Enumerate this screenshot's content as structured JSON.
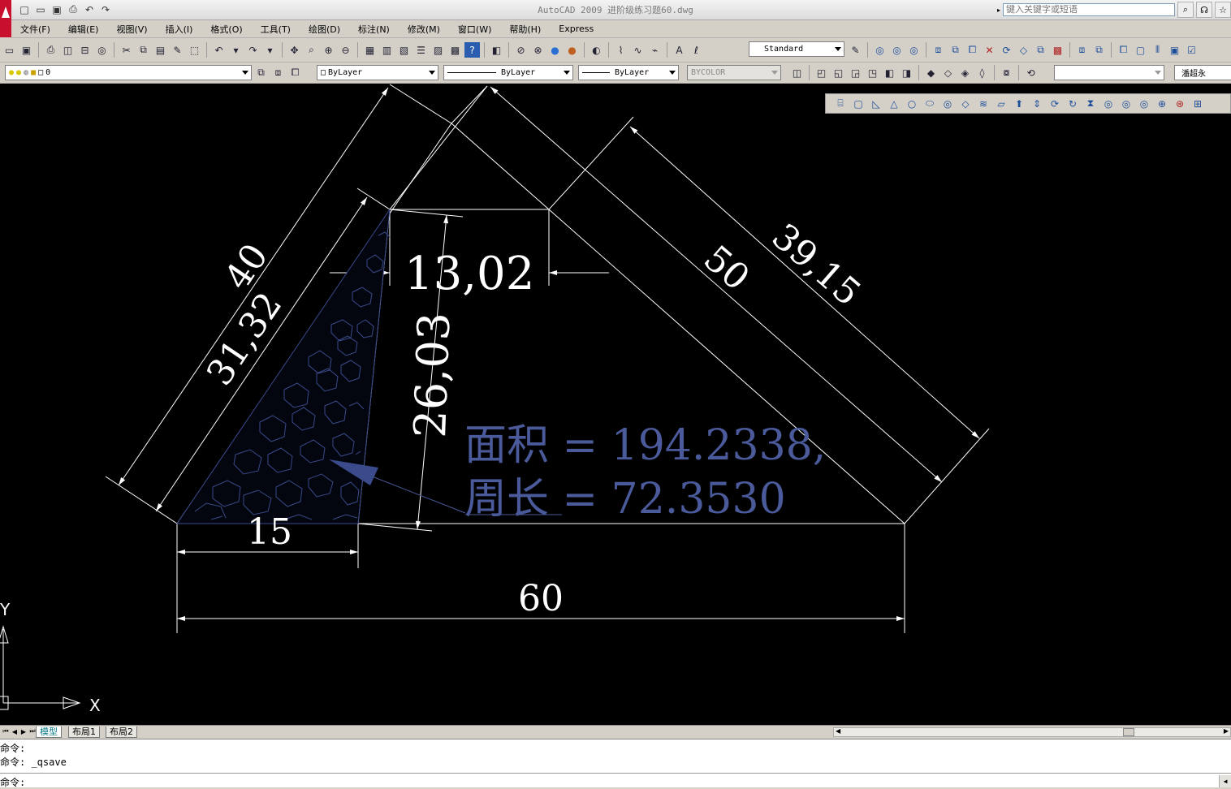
{
  "title": {
    "text": "AutoCAD 2009 进阶级练习题60.dwg",
    "search_placeholder": "键入关键字或短语"
  },
  "menu": [
    "文件(F)",
    "编辑(E)",
    "视图(V)",
    "插入(I)",
    "格式(O)",
    "工具(T)",
    "绘图(D)",
    "标注(N)",
    "修改(M)",
    "窗口(W)",
    "帮助(H)",
    "Express"
  ],
  "toolbar": {
    "text_style": "Standard",
    "layer": "0",
    "color": "ByLayer",
    "linetype": "ByLayer",
    "lineweight": "ByLayer",
    "plotstyle": "BYCOLOR",
    "user": "潘超永"
  },
  "drawing": {
    "dims": {
      "d40": "40",
      "d3132": "31,32",
      "d1302": "13,02",
      "d2603": "26,03",
      "d50": "50",
      "d3915": "39,15",
      "d15": "15",
      "d60": "60"
    },
    "area_text": "面积 = 194.2338,",
    "perimeter_text": "周长 = 72.3530",
    "axis_x": "X",
    "axis_y": "Y",
    "colors": {
      "background": "#000000",
      "lines": "#ffffff",
      "measure": "#4a5a9a",
      "hatch": "#3a4a8a"
    }
  },
  "tabs": {
    "model": "模型",
    "layout1": "布局1",
    "layout2": "布局2"
  },
  "command": {
    "line1": "命令:",
    "line2": "命令: _qsave",
    "prompt": "命令:"
  }
}
